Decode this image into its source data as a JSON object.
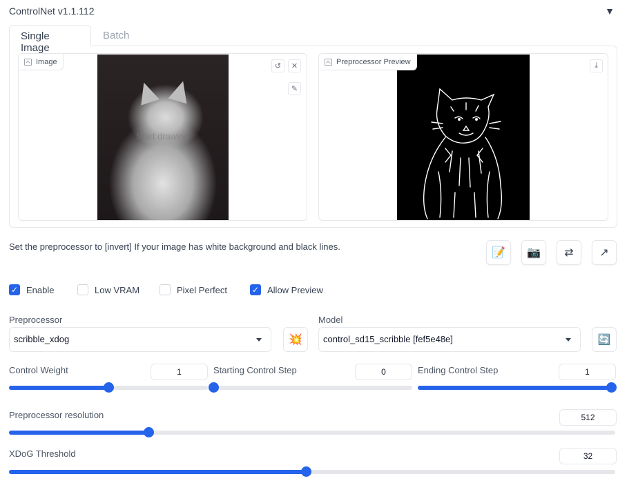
{
  "header": {
    "title": "ControlNet v1.1.112",
    "collapse_icon": "▼"
  },
  "tabs": [
    {
      "label": "Single Image",
      "active": true
    },
    {
      "label": "Batch",
      "active": false
    }
  ],
  "image_panel": {
    "label": "Image",
    "watermark": "Start drawing",
    "buttons": [
      "undo-icon",
      "clear-icon",
      "brush-icon"
    ]
  },
  "preview_panel": {
    "label": "Preprocessor Preview",
    "buttons": [
      "download-icon"
    ]
  },
  "info_text": "Set the preprocessor to [invert] If your image has white background and black lines.",
  "tool_buttons": [
    {
      "name": "notepad-icon",
      "glyph": "📝"
    },
    {
      "name": "camera-icon",
      "glyph": "📷"
    },
    {
      "name": "swap-icon",
      "glyph": "⇄"
    },
    {
      "name": "send-arrow-icon",
      "glyph": "↗"
    }
  ],
  "checkboxes": [
    {
      "label": "Enable",
      "checked": true
    },
    {
      "label": "Low VRAM",
      "checked": false
    },
    {
      "label": "Pixel Perfect",
      "checked": false
    },
    {
      "label": "Allow Preview",
      "checked": true
    }
  ],
  "preprocessor": {
    "label": "Preprocessor",
    "value": "scribble_xdog",
    "run_icon": "💥"
  },
  "model": {
    "label": "Model",
    "value": "control_sd15_scribble [fef5e48e]",
    "refresh_icon": "🔄"
  },
  "sliders": {
    "control_weight": {
      "label": "Control Weight",
      "value": "1",
      "fraction": 0.5
    },
    "starting_step": {
      "label": "Starting Control Step",
      "value": "0",
      "fraction": 0.0
    },
    "ending_step": {
      "label": "Ending Control Step",
      "value": "1",
      "fraction": 1.0
    },
    "resolution": {
      "label": "Preprocessor resolution",
      "value": "512",
      "fraction": 0.23
    },
    "xdog_threshold": {
      "label": "XDoG Threshold",
      "value": "32",
      "fraction": 0.49
    }
  },
  "colors": {
    "accent": "#2563eb",
    "border": "#e5e7eb",
    "track": "#e5e7eb"
  }
}
